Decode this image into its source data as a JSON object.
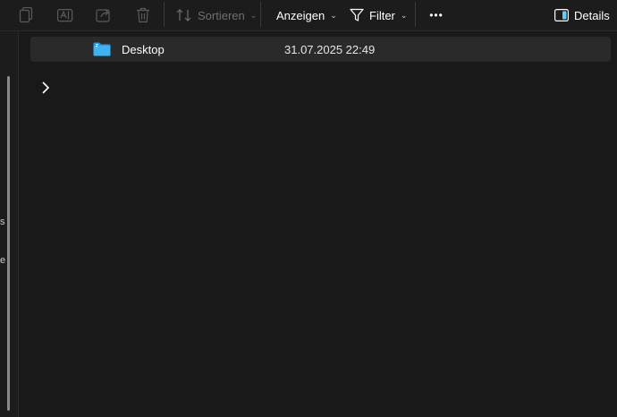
{
  "toolbar": {
    "sort_label": "Sortieren",
    "view_label": "Anzeigen",
    "filter_label": "Filter",
    "more_label": "•••",
    "details_label": "Details"
  },
  "left_pane": {
    "fragment_1": "s",
    "fragment_2": "e"
  },
  "files": [
    {
      "name": "Desktop",
      "date": "31.07.2025 22:49",
      "icon": "folder-icon"
    }
  ],
  "colors": {
    "background": "#191919",
    "toolbar": "#1c1c1c",
    "selected_row": "#2a2a2a",
    "accent": "#60cdff",
    "folder": "#1e9be6"
  }
}
